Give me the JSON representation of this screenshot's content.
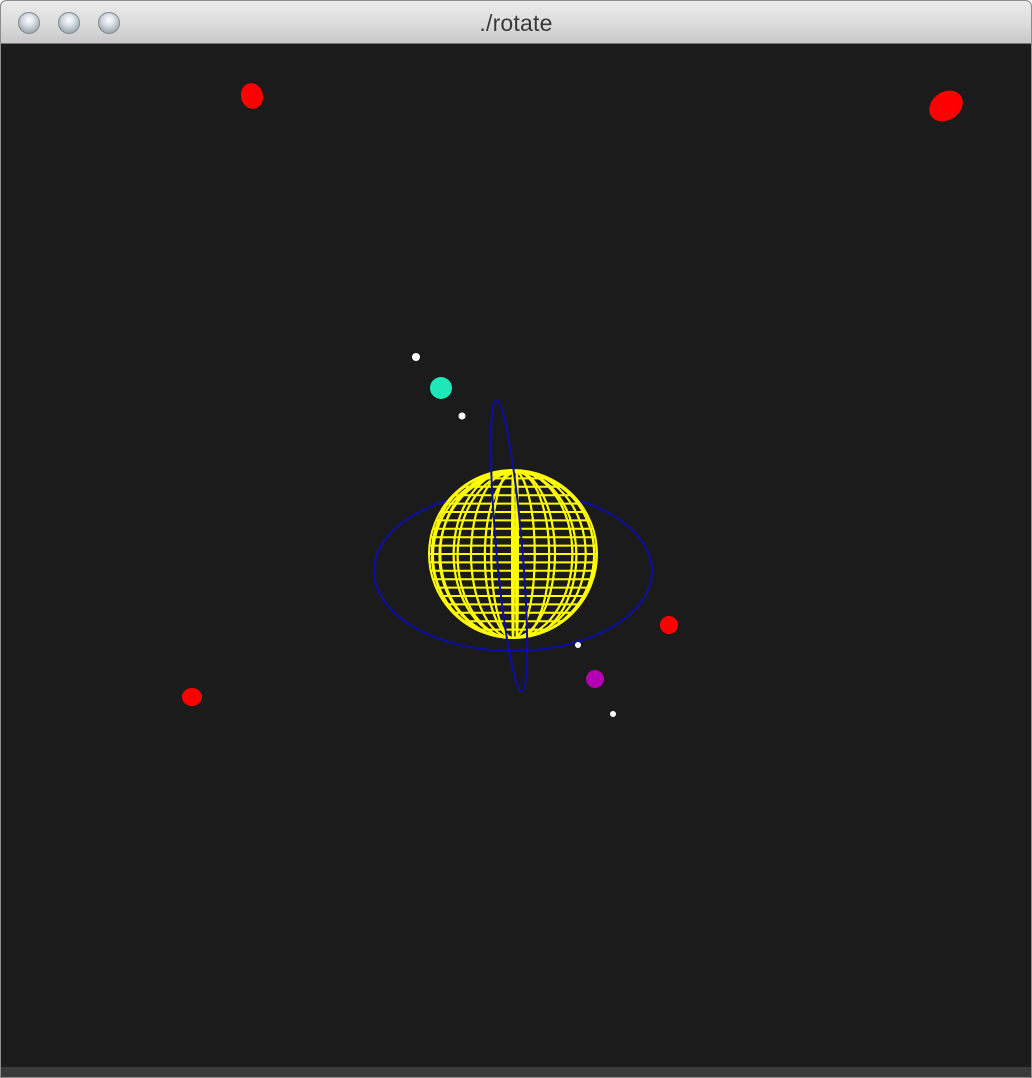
{
  "window": {
    "title": "./rotate",
    "buttons": [
      {
        "name": "close",
        "icon": "close-circle-icon"
      },
      {
        "name": "minimize",
        "icon": "minimize-circle-icon"
      },
      {
        "name": "zoom",
        "icon": "zoom-circle-icon"
      }
    ]
  },
  "scene": {
    "background": "#1b1b1b",
    "sun": {
      "color": "#ffff00",
      "style": "wireframe-sphere"
    },
    "orbit_color": "#0d0da8",
    "planets": [
      {
        "name": "teal-planet",
        "color": "#1de9b6"
      },
      {
        "name": "magenta-planet",
        "color": "#b300b3"
      },
      {
        "name": "red-planet",
        "color": "#ff0000"
      }
    ],
    "moons_color": "#ffffff"
  }
}
